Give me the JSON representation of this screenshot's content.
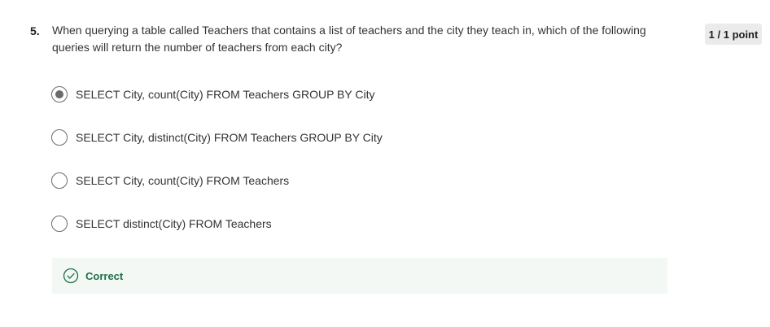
{
  "question": {
    "number": "5.",
    "text": "When querying a table called Teachers that contains a list of teachers and the city they teach in, which of the following queries will return the number of teachers from each city?",
    "points": "1 / 1 point"
  },
  "options": [
    {
      "label": "SELECT City, count(City) FROM Teachers GROUP BY City",
      "selected": true
    },
    {
      "label": "SELECT City, distinct(City) FROM Teachers GROUP BY City",
      "selected": false
    },
    {
      "label": "SELECT City, count(City) FROM Teachers",
      "selected": false
    },
    {
      "label": "SELECT distinct(City) FROM Teachers",
      "selected": false
    }
  ],
  "feedback": {
    "label": "Correct",
    "icon": "check-circle-icon"
  },
  "colors": {
    "correct": "#1f6f4a",
    "feedback_bg": "#f3f8f5",
    "points_bg": "#ebebeb"
  }
}
